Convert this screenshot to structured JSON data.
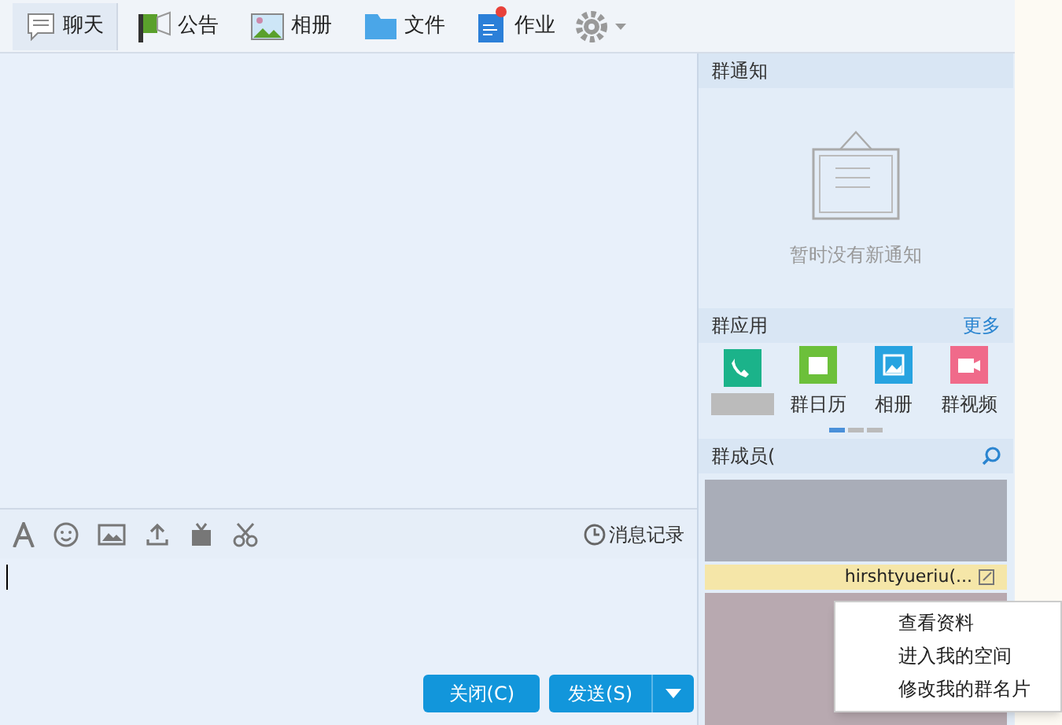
{
  "toolbar": [
    {
      "kind": "chat",
      "label": "聊天",
      "selected": true
    },
    {
      "kind": "notice",
      "label": "公告",
      "selected": false
    },
    {
      "kind": "album",
      "label": "相册",
      "selected": false
    },
    {
      "kind": "file",
      "label": "文件",
      "selected": false
    },
    {
      "kind": "homework",
      "label": "作业",
      "selected": false,
      "badge": true
    }
  ],
  "notice_panel": {
    "title": "群通知",
    "empty_text": "暂时没有新通知"
  },
  "apps_panel": {
    "title": "群应用",
    "more": "更多",
    "apps": [
      {
        "kind": "phone"
      },
      {
        "kind": "calendar",
        "label": "群日历"
      },
      {
        "kind": "album",
        "label": "相册"
      },
      {
        "kind": "video",
        "label": "群视频"
      }
    ]
  },
  "members_panel": {
    "title": "群成员(",
    "member_name": "hirshtyueriu(..."
  },
  "context_menu": [
    "查看资料",
    "进入我的空间",
    "修改我的群名片"
  ],
  "input_toolbar": {
    "history": "消息记录"
  },
  "buttons": {
    "close": "关闭(C)",
    "send": "发送(S)"
  }
}
